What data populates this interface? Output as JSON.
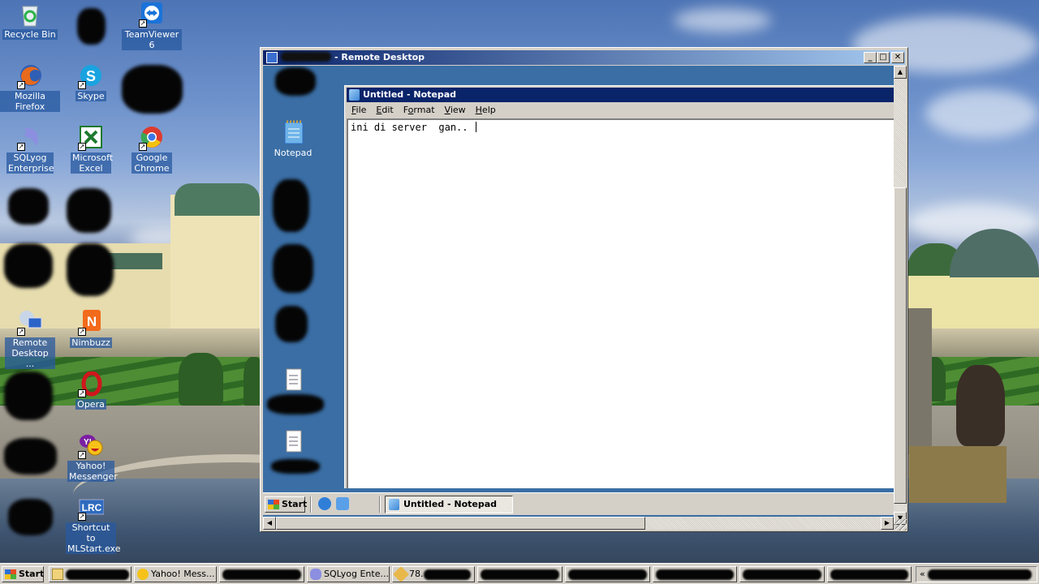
{
  "desktop": {
    "icons": [
      {
        "label": "Recycle Bin",
        "icon": "recycle-bin-icon"
      },
      {
        "label": "TeamViewer 6",
        "icon": "teamviewer-icon"
      },
      {
        "label": "Mozilla Firefox",
        "icon": "firefox-icon"
      },
      {
        "label": "Skype",
        "icon": "skype-icon"
      },
      {
        "label": "SQLyog Enterprise",
        "icon": "sqlyog-icon"
      },
      {
        "label": "Microsoft Excel",
        "icon": "excel-icon"
      },
      {
        "label": "Google Chrome",
        "icon": "chrome-icon"
      },
      {
        "label": "Remote Desktop ...",
        "icon": "remote-desktop-icon"
      },
      {
        "label": "Nimbuzz",
        "icon": "nimbuzz-icon"
      },
      {
        "label": "Opera",
        "icon": "opera-icon"
      },
      {
        "label": "Yahoo! Messenger",
        "icon": "yahoo-messenger-icon"
      },
      {
        "label": "Shortcut to MLStart.exe",
        "icon": "lrc-icon",
        "glyph": "LRC"
      }
    ]
  },
  "rdp_window": {
    "title": "- Remote Desktop",
    "buttons": {
      "minimize": "_",
      "maximize": "□",
      "close": "✕"
    },
    "remote_desktop": {
      "icons": [
        {
          "label": "Notepad",
          "icon": "notepad-icon"
        }
      ]
    },
    "notepad": {
      "title": "Untitled - Notepad",
      "menu": [
        {
          "label": "File",
          "accel": "F",
          "rest": "ile"
        },
        {
          "label": "Edit",
          "accel": "E",
          "rest": "dit"
        },
        {
          "label": "Format",
          "accel_prefix": "F",
          "accel": "o",
          "rest": "rmat"
        },
        {
          "label": "View",
          "accel": "V",
          "rest": "iew"
        },
        {
          "label": "Help",
          "accel": "H",
          "rest": "elp"
        }
      ],
      "content": "ini di server  gan.. "
    },
    "remote_taskbar": {
      "start_label": "Start",
      "task_label": "Untitled - Notepad"
    }
  },
  "taskbar": {
    "start_label": "Start",
    "items": [
      {
        "label": "",
        "icon": "folder-icon",
        "redacted": true
      },
      {
        "label": "Yahoo! Mess...",
        "icon": "yahoo-icon"
      },
      {
        "label": "",
        "redacted": true
      },
      {
        "label": "SQLyog Ente...",
        "icon": "sqlyog-icon"
      },
      {
        "label": "78.",
        "icon": "putty-icon",
        "partially_redacted": true
      },
      {
        "label": "",
        "redacted": true
      },
      {
        "label": "",
        "redacted": true
      },
      {
        "label": "",
        "redacted": true
      },
      {
        "label": "",
        "redacted": true
      },
      {
        "label": "",
        "redacted": true
      }
    ],
    "tray_expand": "«"
  }
}
